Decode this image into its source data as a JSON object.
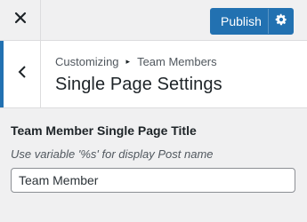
{
  "header": {
    "close_icon": "close-icon",
    "publish_label": "Publish",
    "settings_icon": "gear-icon"
  },
  "section": {
    "back_icon": "chevron-left-icon",
    "breadcrumb_root": "Customizing",
    "breadcrumb_separator": "▸",
    "breadcrumb_current": "Team Members",
    "title": "Single Page Settings"
  },
  "control": {
    "label": "Team Member Single Page Title",
    "description": "Use variable '%s' for display Post name",
    "value": "Team Member"
  },
  "colors": {
    "accent": "#2271b1",
    "panel_bg": "#f0f0f1",
    "header_bg": "#ffffff"
  }
}
